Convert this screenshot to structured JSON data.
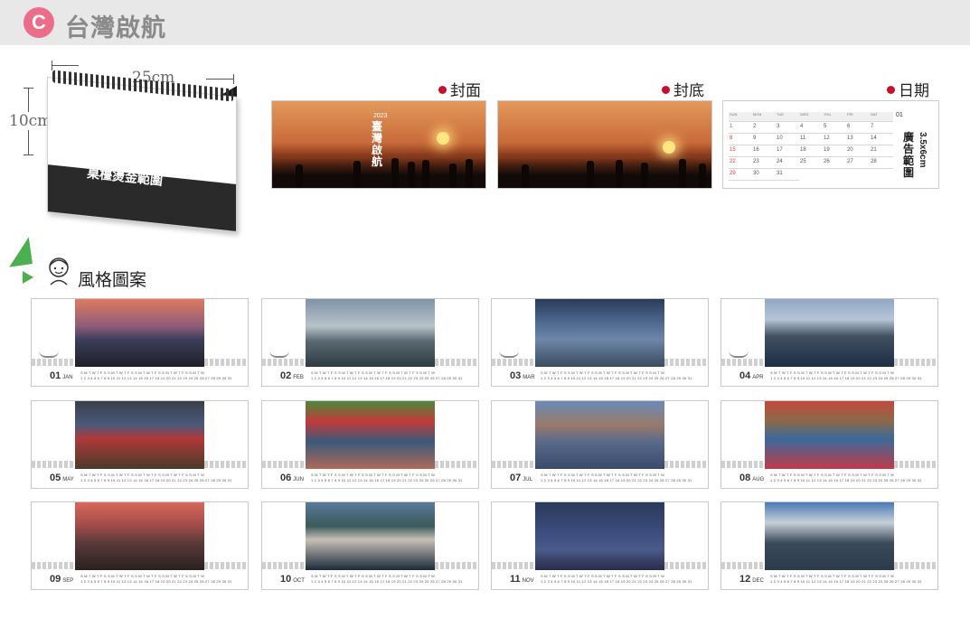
{
  "header": {
    "badge": "C",
    "title": "台灣啟航"
  },
  "desk": {
    "width_label": "25cm",
    "height_label": "10cm",
    "base_text": "桌檯燙金範圍"
  },
  "panels": {
    "cover": {
      "label": "封面",
      "title_text": "臺灣啟航",
      "year": "2023"
    },
    "back": {
      "label": "封底"
    },
    "date": {
      "label": "日期",
      "month": "01",
      "ad_text": "廣告範圍",
      "ad_size": "3.5x6cm"
    }
  },
  "date_grid": {
    "weekdays": [
      "SUN",
      "MON",
      "TUE",
      "WED",
      "THU",
      "FRI",
      "SAT"
    ],
    "days": [
      "1",
      "2",
      "3",
      "4",
      "5",
      "6",
      "7",
      "8",
      "9",
      "10",
      "11",
      "12",
      "13",
      "14",
      "15",
      "16",
      "17",
      "18",
      "19",
      "20",
      "21",
      "22",
      "23",
      "24",
      "25",
      "26",
      "27",
      "28",
      "29",
      "30",
      "31"
    ]
  },
  "section": {
    "title": "風格圖案"
  },
  "cal_strip": {
    "head": "S M T W T F S S M T W T F S S M T W T F S S M T W T F S S M T W",
    "days": "1 2 3 4 5 6 7 8 9 10 11 12 13 14 15 16 17 18 19 20 21 22 23 24 25 26 27 28 29 30 31"
  },
  "months": [
    {
      "num": "01",
      "abbr": "JAN"
    },
    {
      "num": "02",
      "abbr": "FEB"
    },
    {
      "num": "03",
      "abbr": "MAR"
    },
    {
      "num": "04",
      "abbr": "APR"
    },
    {
      "num": "05",
      "abbr": "MAY"
    },
    {
      "num": "06",
      "abbr": "JUN"
    },
    {
      "num": "07",
      "abbr": "JUL"
    },
    {
      "num": "08",
      "abbr": "AUG"
    },
    {
      "num": "09",
      "abbr": "SEP"
    },
    {
      "num": "10",
      "abbr": "OCT"
    },
    {
      "num": "11",
      "abbr": "NOV"
    },
    {
      "num": "12",
      "abbr": "DEC"
    }
  ],
  "colors": {
    "badge": "#ec6d8a",
    "dot": "#c8102e",
    "accent_green": "#4caf50"
  }
}
